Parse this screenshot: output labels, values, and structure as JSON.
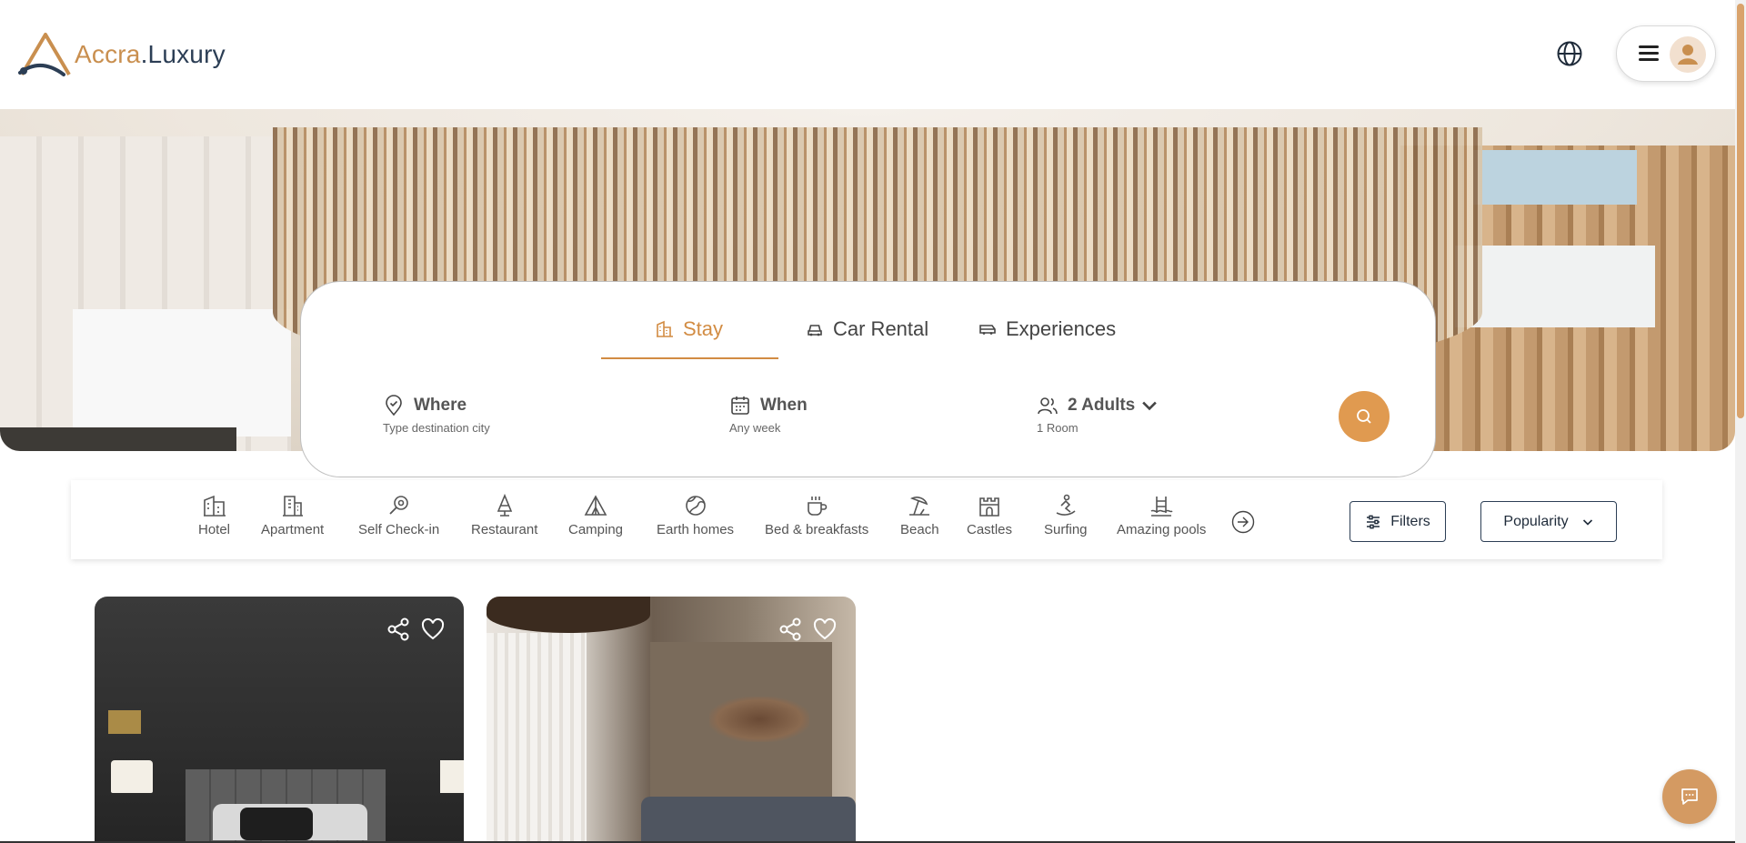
{
  "brand": {
    "name_part1": "Accra",
    "name_part2": ".Luxury"
  },
  "header": {
    "globe_icon": "globe-icon",
    "menu_icon": "hamburger-icon",
    "avatar_icon": "user-avatar-icon"
  },
  "colors": {
    "accent": "#d28c43",
    "search_button": "#e09a50",
    "brand_gold": "#c98f4f",
    "brand_navy": "#2c3e55"
  },
  "search": {
    "tabs": [
      {
        "label": "Stay",
        "icon": "building-icon",
        "active": true
      },
      {
        "label": "Car Rental",
        "icon": "car-icon",
        "active": false
      },
      {
        "label": "Experiences",
        "icon": "van-icon",
        "active": false
      }
    ],
    "where": {
      "label": "Where",
      "placeholder": "Type destination city"
    },
    "when": {
      "label": "When",
      "value": "Any week"
    },
    "guests": {
      "label": "2 Adults",
      "sub": "1 Room"
    }
  },
  "categories": [
    {
      "label": "Hotel",
      "icon": "hotel-icon"
    },
    {
      "label": "Apartment",
      "icon": "apartment-icon"
    },
    {
      "label": "Self Check-in",
      "icon": "key-search-icon"
    },
    {
      "label": "Restaurant",
      "icon": "restaurant-icon"
    },
    {
      "label": "Camping",
      "icon": "tent-icon"
    },
    {
      "label": "Earth homes",
      "icon": "earth-icon"
    },
    {
      "label": "Bed & breakfasts",
      "icon": "coffee-icon"
    },
    {
      "label": "Beach",
      "icon": "beach-icon"
    },
    {
      "label": "Castles",
      "icon": "castle-icon"
    },
    {
      "label": "Surfing",
      "icon": "surfing-icon"
    },
    {
      "label": "Amazing pools",
      "icon": "pool-icon"
    }
  ],
  "toolbar": {
    "filters_label": "Filters",
    "sort_label": "Popularity"
  },
  "listings": [
    {
      "share_icon": "share-icon",
      "favorite_icon": "heart-icon"
    },
    {
      "share_icon": "share-icon",
      "favorite_icon": "heart-icon"
    }
  ],
  "chat": {
    "icon": "chat-icon"
  }
}
